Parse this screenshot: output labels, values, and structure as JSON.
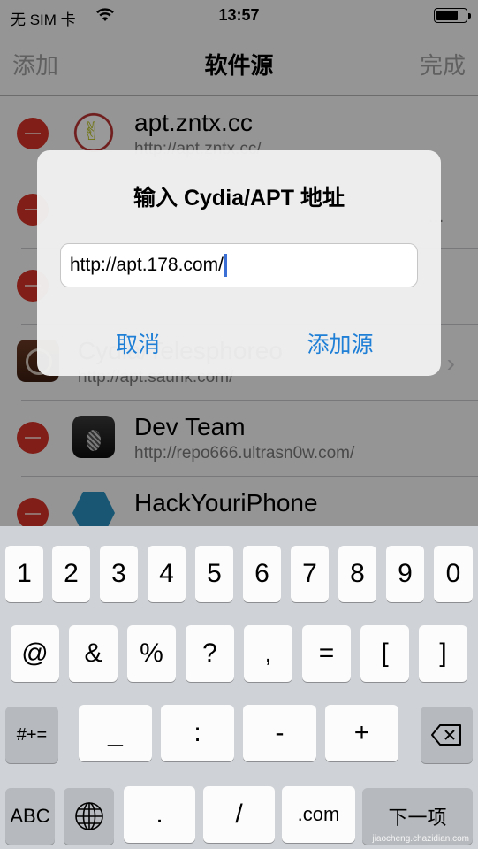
{
  "status_bar": {
    "carrier": "无 SIM 卡",
    "wifi_icon": "wifi-icon",
    "time": "13:57",
    "battery_icon": "battery-icon",
    "battery_level_fraction": 0.75
  },
  "navbar": {
    "left_button": "添加",
    "title": "软件源",
    "right_button": "完成"
  },
  "sources": [
    {
      "name": "apt.zntx.cc",
      "url": "http://apt.zntx.cc/",
      "icon": "rock-hand-icon",
      "deletable": true,
      "chevron": false
    },
    {
      "name": "",
      "url": "…",
      "icon": "",
      "deletable": true,
      "chevron": false
    },
    {
      "name": "",
      "url": "",
      "icon": "",
      "deletable": true,
      "chevron": false
    },
    {
      "name": "Cydia/Telesphoreo",
      "url": "http://apt.saurik.com/",
      "icon": "cydia-icon",
      "deletable": false,
      "chevron": true
    },
    {
      "name": "Dev Team",
      "url": "http://repo666.ultrasn0w.com/",
      "icon": "pineapple-icon",
      "deletable": true,
      "chevron": false
    },
    {
      "name": "HackYouriPhone",
      "url": "",
      "icon": "hackyouriphone-icon",
      "deletable": true,
      "chevron": false
    }
  ],
  "alert": {
    "title": "输入 Cydia/APT 地址",
    "input_value": "http://apt.178.com/",
    "cancel_label": "取消",
    "confirm_label": "添加源"
  },
  "keyboard": {
    "row1": [
      "1",
      "2",
      "3",
      "4",
      "5",
      "6",
      "7",
      "8",
      "9",
      "0"
    ],
    "row2": [
      "@",
      "&",
      "%",
      "?",
      ",",
      "=",
      "[",
      "]"
    ],
    "row3": {
      "toggle": "#+=",
      "keys": [
        "_",
        ":",
        "-",
        "+"
      ],
      "delete_icon": "backspace-icon"
    },
    "row4": {
      "abc": "ABC",
      "globe_icon": "globe-icon",
      "keys": [
        ".",
        "/",
        ".com"
      ],
      "next": "下一项"
    }
  },
  "watermark": "jiaocheng.chazidian.com"
}
